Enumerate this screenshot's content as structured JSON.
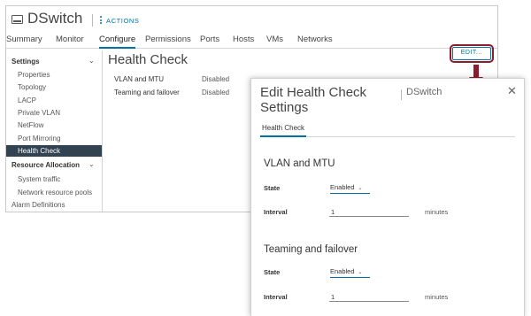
{
  "window": {
    "title": "DSwitch",
    "actions_label": "ACTIONS"
  },
  "tabs": [
    "Summary",
    "Monitor",
    "Configure",
    "Permissions",
    "Ports",
    "Hosts",
    "VMs",
    "Networks"
  ],
  "active_tab": "Configure",
  "sidebar": {
    "settings_header": "Settings",
    "settings_items": [
      "Properties",
      "Topology",
      "LACP",
      "Private VLAN",
      "NetFlow",
      "Port Mirroring",
      "Health Check"
    ],
    "selected_item": "Health Check",
    "resource_header": "Resource Allocation",
    "resource_items": [
      "System traffic",
      "Network resource pools"
    ],
    "alarm_definitions": "Alarm Definitions"
  },
  "content": {
    "title": "Health Check",
    "rows": [
      {
        "label": "VLAN and MTU",
        "value": "Disabled"
      },
      {
        "label": "Teaming and failover",
        "value": "Disabled"
      }
    ],
    "edit_label": "EDIT..."
  },
  "dialog": {
    "title": "Edit Health Check Settings",
    "subtitle": "DSwitch",
    "tab": "Health Check",
    "sections": [
      {
        "title": "VLAN and MTU",
        "state_label": "State",
        "state_value": "Enabled",
        "interval_label": "Interval",
        "interval_value": "1",
        "interval_units": "minutes"
      },
      {
        "title": "Teaming and failover",
        "state_label": "State",
        "state_value": "Enabled",
        "interval_label": "Interval",
        "interval_value": "1",
        "interval_units": "minutes"
      }
    ]
  },
  "colors": {
    "accent": "#0072a3",
    "selected_bg": "#314351",
    "highlight": "#8e1b2e"
  },
  "icons": {
    "switch": "dswitch-icon",
    "actions": "vertical-dots-icon",
    "chevron": "chevron-down-icon",
    "close": "close-icon",
    "arrow": "arrow-down-icon"
  }
}
